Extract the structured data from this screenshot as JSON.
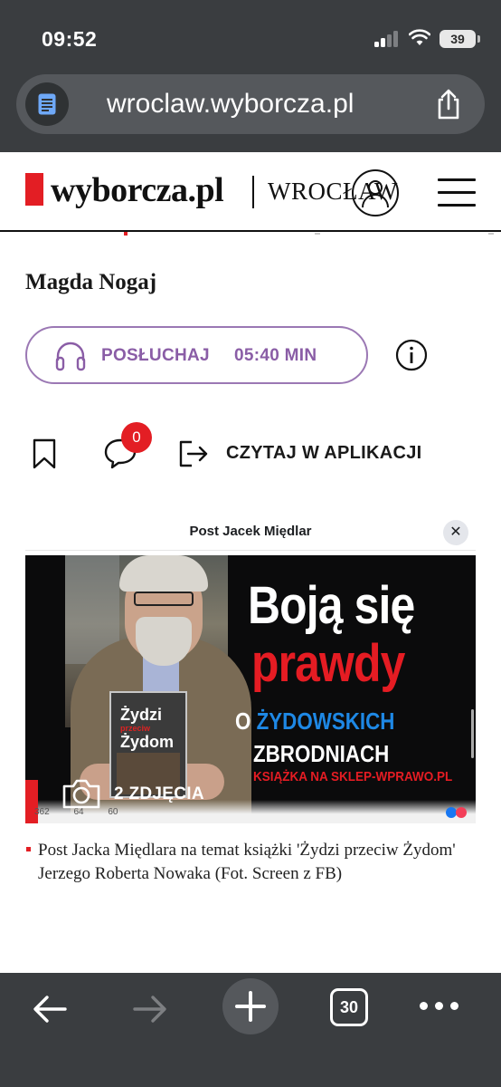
{
  "status_bar": {
    "time": "09:52",
    "battery": "39"
  },
  "browser": {
    "url": "wroclaw.wyborcza.pl",
    "open_tabs": "30"
  },
  "site": {
    "logo_text": "wyborcza.pl",
    "city": "WROCŁAW",
    "brand_color": "#e31e24"
  },
  "article": {
    "author": "Magda Nogaj",
    "listen_label": "POSŁUCHAJ",
    "listen_duration": "05:40 MIN",
    "comment_count": "0",
    "open_in_app_label": "CZYTAJ W APLIKACJI",
    "accent_color": "#8a5da6"
  },
  "embedded_post": {
    "header_title": "Post Jacek Międlar",
    "headline_line1": "Boją się",
    "headline_line2": "prawdy",
    "headline_line3_a": "O ",
    "headline_line3_b": "ŻYDOWSKICH",
    "headline_line4": "ZBRODNIACH",
    "headline_line5": "KSIĄŻKA NA SKLEP-WPRAWO.PL",
    "book_title_1": "Żydzi",
    "book_title_2": "przeciw",
    "book_title_3": "Żydom",
    "stat_likes": "362",
    "stat_comments": "64",
    "stat_shares": "60",
    "photos_label": "2 ZDJĘCIA"
  },
  "caption": "Post Jacka Międlara na temat książki 'Żydzi przeciw Żydom' Jerzego Roberta Nowaka (Fot. Screen z FB)",
  "icons": {
    "reader": "reader-mode-icon",
    "share": "share-icon",
    "account": "account-icon",
    "menu": "hamburger-menu-icon",
    "headphones": "headphones-icon",
    "info": "info-icon",
    "bookmark": "bookmark-icon",
    "comment": "comment-icon",
    "open_app": "open-in-app-icon",
    "camera": "camera-icon",
    "back": "back-arrow-icon",
    "forward": "forward-arrow-icon",
    "new_tab": "plus-icon",
    "more": "more-dots-icon"
  }
}
